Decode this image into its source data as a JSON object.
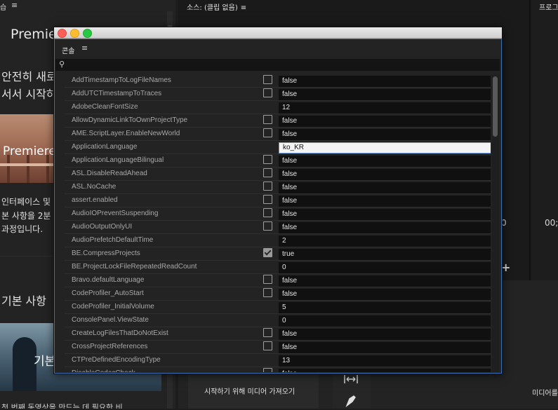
{
  "background": {
    "left_panel": {
      "header_title": "습",
      "title": "Premie",
      "text_line1": "안전히 새로",
      "text_line2": "서서 시작하",
      "image1_label": "Premiere",
      "para_line1": "인터페이스 및",
      "para_line2": "본 사항을 2분",
      "para_line3": "과정입니다.",
      "basics_heading": "기본 사항",
      "image2_label": "기본",
      "bottom_text": "첫 번째 동영상을 만드는 데 필요한 비"
    },
    "source_panel": {
      "header": "소스: (클립 없음)",
      "import_text": "시작하기 위해 미디어 가져오기"
    },
    "program_panel": {
      "header": "프로그",
      "media_text": "미디어를"
    },
    "timecode_left": "0",
    "timecode_right": "00;",
    "plus_symbol": "+",
    "menu_symbol": "≡"
  },
  "console": {
    "title": "콘솔",
    "menu_symbol": "≡",
    "search_placeholder": "",
    "rows": [
      {
        "key": "AddTimestampToLogFileNames",
        "checkbox": true,
        "checked": false,
        "value": "false"
      },
      {
        "key": "AddUTCTimestampToTraces",
        "checkbox": true,
        "checked": false,
        "value": "false"
      },
      {
        "key": "AdobeCleanFontSize",
        "checkbox": false,
        "checked": false,
        "value": "12"
      },
      {
        "key": "AllowDynamicLinkToOwnProjectType",
        "checkbox": true,
        "checked": false,
        "value": "false"
      },
      {
        "key": "AME.ScriptLayer.EnableNewWorld",
        "checkbox": true,
        "checked": false,
        "value": "false"
      },
      {
        "key": "ApplicationLanguage",
        "checkbox": false,
        "checked": false,
        "value": "ko_KR",
        "editing": true
      },
      {
        "key": "ApplicationLanguageBilingual",
        "checkbox": true,
        "checked": false,
        "value": "false"
      },
      {
        "key": "ASL.DisableReadAhead",
        "checkbox": true,
        "checked": false,
        "value": "false"
      },
      {
        "key": "ASL.NoCache",
        "checkbox": true,
        "checked": false,
        "value": "false"
      },
      {
        "key": "assert.enabled",
        "checkbox": true,
        "checked": false,
        "value": "false"
      },
      {
        "key": "AudioIOPreventSuspending",
        "checkbox": true,
        "checked": false,
        "value": "false"
      },
      {
        "key": "AudioOutputOnlyUI",
        "checkbox": true,
        "checked": false,
        "value": "false"
      },
      {
        "key": "AudioPrefetchDefaultTime",
        "checkbox": false,
        "checked": false,
        "value": "2"
      },
      {
        "key": "BE.CompressProjects",
        "checkbox": true,
        "checked": true,
        "value": "true"
      },
      {
        "key": "BE.ProjectLockFileRepeatedReadCount",
        "checkbox": false,
        "checked": false,
        "value": "0"
      },
      {
        "key": "Bravo.defaultLanguage",
        "checkbox": true,
        "checked": false,
        "value": "false"
      },
      {
        "key": "CodeProfiler_AutoStart",
        "checkbox": true,
        "checked": false,
        "value": "false"
      },
      {
        "key": "CodeProfiler_InitialVolume",
        "checkbox": false,
        "checked": false,
        "value": "5"
      },
      {
        "key": "ConsolePanel.ViewState",
        "checkbox": false,
        "checked": false,
        "value": "0"
      },
      {
        "key": "CreateLogFilesThatDoNotExist",
        "checkbox": true,
        "checked": false,
        "value": "false"
      },
      {
        "key": "CrossProjectReferences",
        "checkbox": true,
        "checked": false,
        "value": "false"
      },
      {
        "key": "CTPreDefinedEncodingType",
        "checkbox": false,
        "checked": false,
        "value": "13"
      },
      {
        "key": "DisableCodecCheck",
        "checkbox": true,
        "checked": false,
        "value": "false"
      }
    ]
  }
}
